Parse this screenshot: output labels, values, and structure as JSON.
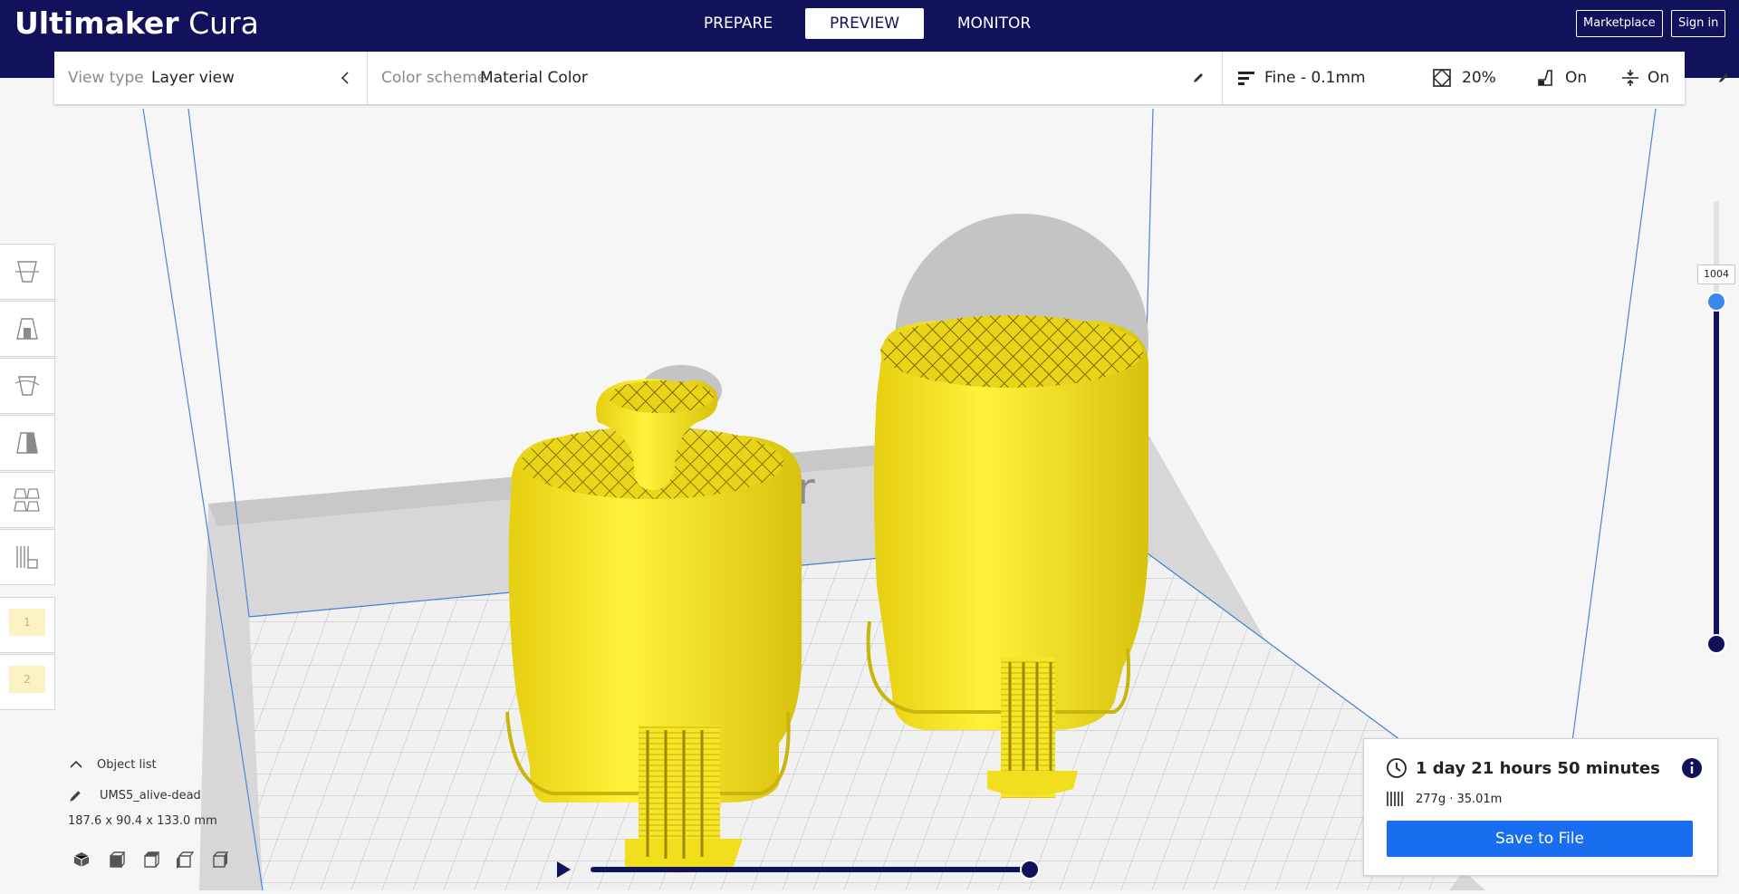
{
  "app": {
    "brand": "Ultimaker",
    "product": "Cura"
  },
  "stages": [
    {
      "label": "PREPARE",
      "active": false
    },
    {
      "label": "PREVIEW",
      "active": true
    },
    {
      "label": "MONITOR",
      "active": false
    }
  ],
  "top_buttons": {
    "marketplace": "Marketplace",
    "sign_in": "Sign in"
  },
  "header": {
    "view_type_label": "View type",
    "view_type_value": "Layer view",
    "color_scheme_label": "Color scheme",
    "color_scheme_value": "Material Color",
    "print_settings": {
      "profile": "Fine - 0.1mm",
      "infill": "20%",
      "support": "On",
      "adhesion": "On"
    }
  },
  "layer_slider": {
    "current_layer": "1004"
  },
  "object_list": {
    "title": "Object list",
    "object_name": "UMS5_alive-dead",
    "dimensions": "187.6 x 90.4 x 133.0 mm"
  },
  "print_info": {
    "time": "1 day 21 hours 50 minutes",
    "material": "277g · 35.01m",
    "save_label": "Save to File"
  },
  "extension_slots": [
    "1",
    "2"
  ],
  "colors": {
    "topbar": "#12125c",
    "accent": "#196ef0",
    "model": "#f5e020",
    "plate_grid": "#b9b9b9"
  }
}
